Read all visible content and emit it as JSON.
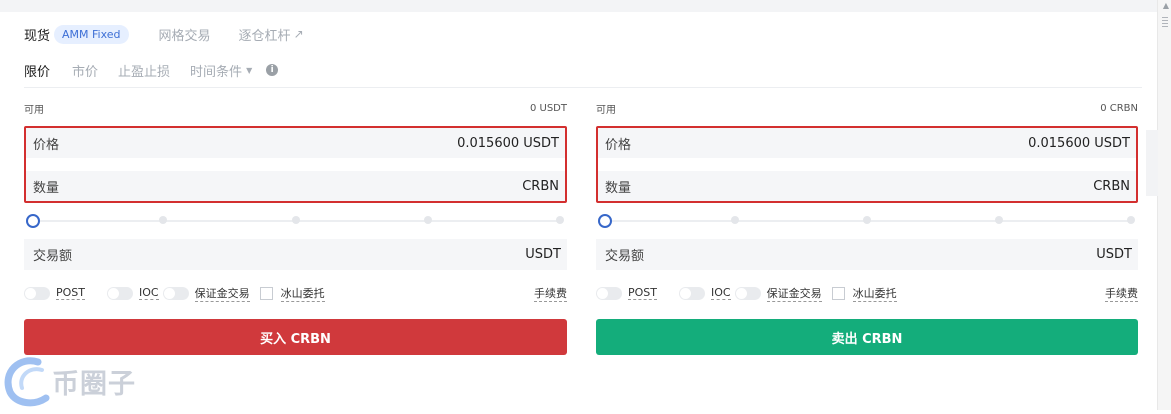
{
  "tabs": {
    "spot": "现货",
    "amm_badge": "AMM Fixed",
    "grid": "网格交易",
    "isolated": "逐仓杠杆"
  },
  "order_types": {
    "limit": "限价",
    "market": "市价",
    "tpsl": "止盈止损",
    "time_condition": "时间条件"
  },
  "buy": {
    "avail_label": "可用",
    "avail_value": "0 USDT",
    "price_label": "价格",
    "price_value": "0.015600 USDT",
    "qty_label": "数量",
    "qty_unit": "CRBN",
    "amount_label": "交易额",
    "amount_unit": "USDT",
    "button_label": "买入 CRBN"
  },
  "sell": {
    "avail_label": "可用",
    "avail_value": "0 CRBN",
    "price_label": "价格",
    "price_value": "0.015600 USDT",
    "qty_label": "数量",
    "qty_unit": "CRBN",
    "amount_label": "交易额",
    "amount_unit": "USDT",
    "button_label": "卖出 CRBN"
  },
  "options": {
    "post": "POST",
    "ioc": "IOC",
    "margin": "保证金交易",
    "iceberg": "冰山委托",
    "fee": "手续费"
  },
  "watermark": "币圈子",
  "colors": {
    "buy": "#d0393c",
    "sell": "#14ad7b",
    "highlight": "#d32f2f",
    "accent": "#3767c9"
  }
}
